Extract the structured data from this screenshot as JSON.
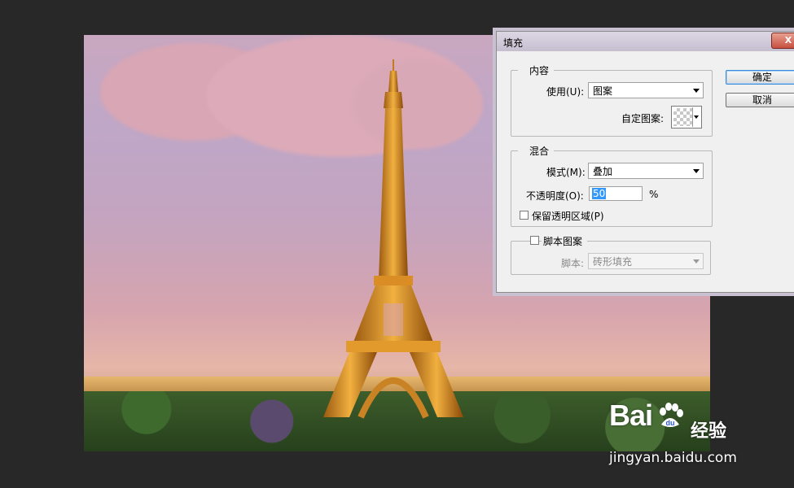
{
  "dialog": {
    "title": "填充",
    "close_label": "X",
    "content_group": {
      "label": "内容",
      "use_label": "使用(U):",
      "use_value": "图案",
      "custom_pattern_label": "自定图案:"
    },
    "blend_group": {
      "label": "混合",
      "mode_label": "模式(M):",
      "mode_value": "叠加",
      "opacity_label": "不透明度(O):",
      "opacity_value": "50",
      "opacity_unit": "%",
      "preserve_label": "保留透明区域(P)",
      "preserve_checked": false
    },
    "script_group": {
      "label": "脚本图案",
      "checked": false,
      "script_label": "脚本:",
      "script_value": "砖形填充"
    },
    "ok_label": "确定",
    "cancel_label": "取消"
  },
  "watermark": {
    "brand": "Bai",
    "brand_du": "du",
    "cn": "经验",
    "url": "jingyan.baidu.com"
  },
  "colors": {
    "selection": "#3399ff",
    "default_button_border": "#3a8bd8"
  }
}
